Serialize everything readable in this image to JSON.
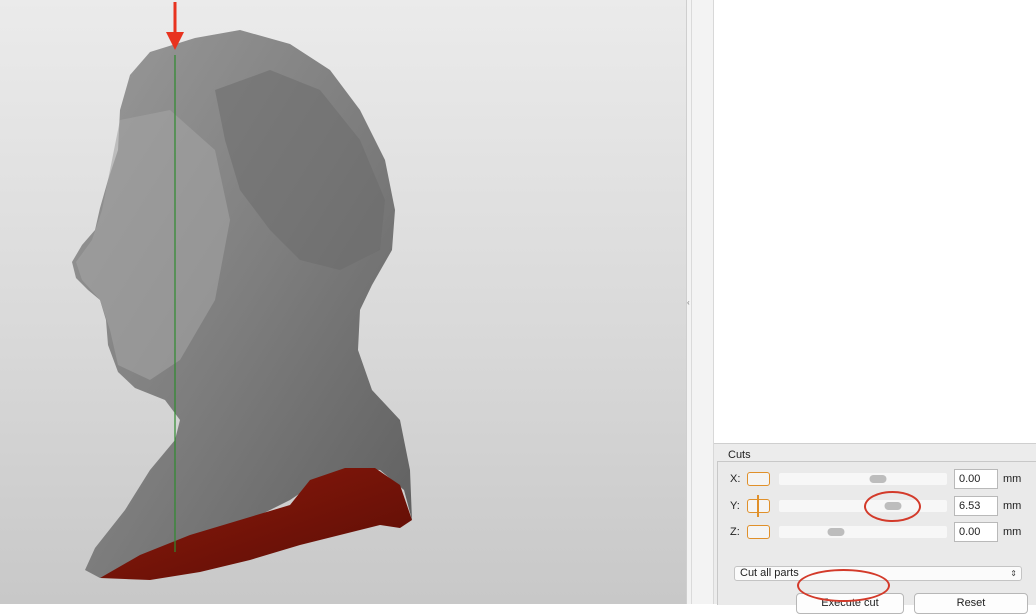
{
  "cuts_panel": {
    "title": "Cuts",
    "axes": [
      {
        "label": "X:",
        "value": "0.00",
        "unit": "mm",
        "slider_position": 0.59
      },
      {
        "label": "Y:",
        "value": "6.53",
        "unit": "mm",
        "slider_position": 0.68
      },
      {
        "label": "Z:",
        "value": "0.00",
        "unit": "mm",
        "slider_position": 0.34
      }
    ],
    "cut_mode": {
      "selected": "Cut all parts",
      "arrows": "⇕"
    },
    "execute_label": "Execute cut",
    "reset_label": "Reset"
  },
  "annotations": {
    "color": "#d33a2a"
  },
  "viewport": {
    "cut_plane_color": "#2e8b2e",
    "cut_surface_color": "#7a1208",
    "model_color": "#8a8a8a"
  }
}
